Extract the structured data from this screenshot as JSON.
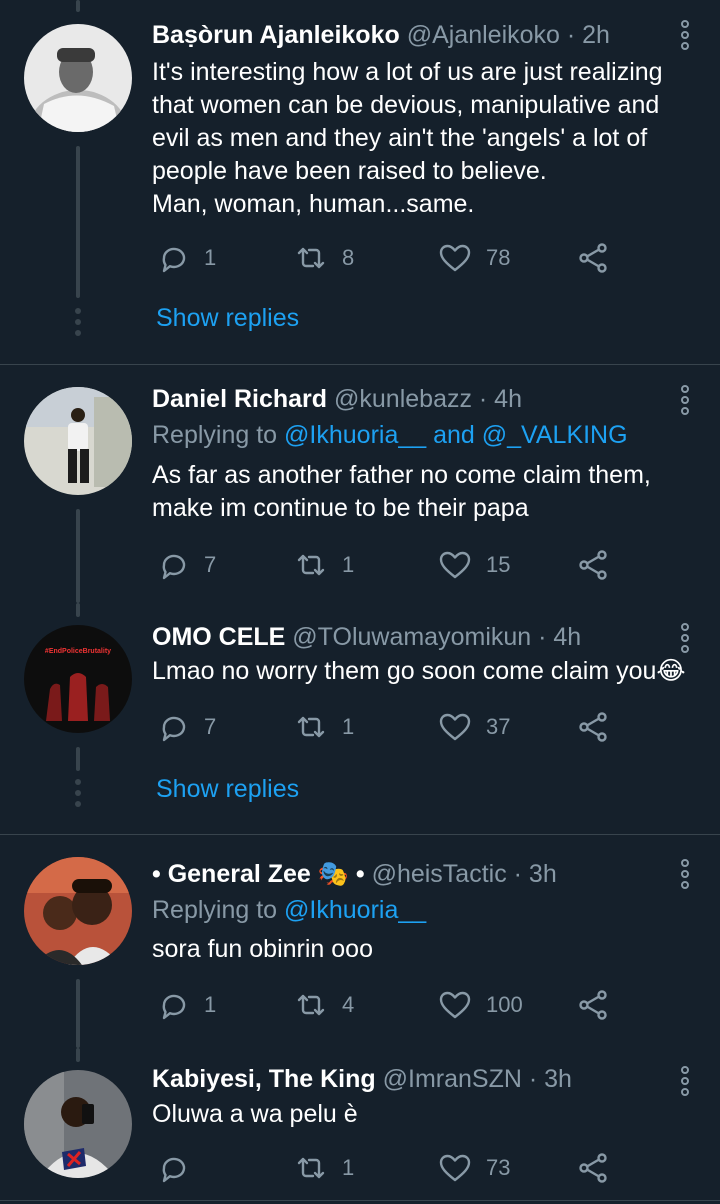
{
  "tweets": [
    {
      "name": "Baṣòrun Ajanleikoko",
      "handle": "@Ajanleikoko · 2h",
      "replying_prefix": "",
      "replying_to": "",
      "body": "It's interesting how a lot of us are just realizing that women can be devious, manipulative and evil as men and they ain't the 'angels' a lot of people have been raised to believe.\nMan, woman, human...same.",
      "replies": "1",
      "retweets": "8",
      "likes": "78"
    },
    {
      "name": "Daniel Richard",
      "handle": "@kunlebazz · 4h",
      "replying_prefix": "Replying to ",
      "replying_to": "@Ikhuoria__ and @_VALKING",
      "body": "As far as another father no come claim them, make im continue to be their papa",
      "replies": "7",
      "retweets": "1",
      "likes": "15"
    },
    {
      "name": "OMO CELE",
      "handle": "@TOluwamayomikun · 4h",
      "replying_prefix": "",
      "replying_to": "",
      "body": "Lmao no worry them go soon come claim you😂",
      "replies": "7",
      "retweets": "1",
      "likes": "37",
      "avatar_text": "#EndPoliceBrutality"
    },
    {
      "name": "• General Zee 🎭 •",
      "handle": "@heisTactic · 3h",
      "replying_prefix": "Replying to ",
      "replying_to": "@Ikhuoria__",
      "body": "sora fun obinrin ooo",
      "replies": "1",
      "retweets": "4",
      "likes": "100"
    },
    {
      "name": "Kabiyesi, The King",
      "handle": "@ImranSZN · 3h",
      "replying_prefix": "",
      "replying_to": "",
      "body": "Oluwa a wa pelu è",
      "replies": "",
      "retweets": "1",
      "likes": "73"
    }
  ],
  "show_replies_label": "Show replies",
  "colors": {
    "background": "#15202b",
    "accent": "#1da1f2",
    "muted": "#8899a6",
    "divider": "#38444d"
  },
  "icons": [
    "reply-icon",
    "retweet-icon",
    "like-icon",
    "share-icon",
    "more-icon"
  ]
}
